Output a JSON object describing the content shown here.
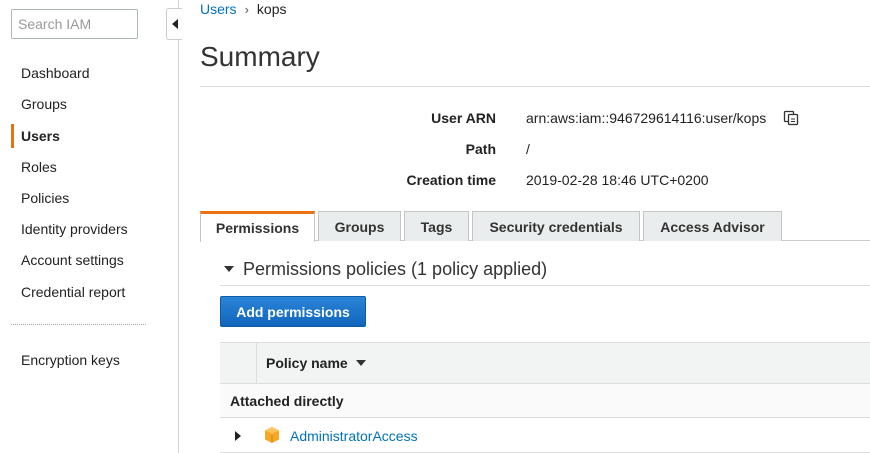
{
  "sidebar": {
    "search_placeholder": "Search IAM",
    "items": [
      {
        "label": "Dashboard"
      },
      {
        "label": "Groups"
      },
      {
        "label": "Users"
      },
      {
        "label": "Roles"
      },
      {
        "label": "Policies"
      },
      {
        "label": "Identity providers"
      },
      {
        "label": "Account settings"
      },
      {
        "label": "Credential report"
      },
      {
        "label": "Encryption keys"
      }
    ],
    "active_item": "Users"
  },
  "breadcrumb": {
    "parent": "Users",
    "current": "kops"
  },
  "page_title": "Summary",
  "summary": {
    "arn_label": "User ARN",
    "arn_value": "arn:aws:iam::946729614116:user/kops",
    "path_label": "Path",
    "path_value": "/",
    "created_label": "Creation time",
    "created_value": "2019-02-28 18:46 UTC+0200"
  },
  "tabs": [
    {
      "label": "Permissions"
    },
    {
      "label": "Groups"
    },
    {
      "label": "Tags"
    },
    {
      "label": "Security credentials"
    },
    {
      "label": "Access Advisor"
    }
  ],
  "active_tab": "Permissions",
  "permissions": {
    "section_title": "Permissions policies (1 policy applied)",
    "add_button": "Add permissions",
    "column_policy_name": "Policy name",
    "group_label": "Attached directly",
    "policies": [
      {
        "name": "AdministratorAccess",
        "icon": "aws-managed-policy-icon"
      }
    ]
  },
  "colors": {
    "accent": "#ec7211",
    "link": "#0073bb",
    "primary_button": "#1a73c9",
    "policy_icon": "#f5a623"
  }
}
